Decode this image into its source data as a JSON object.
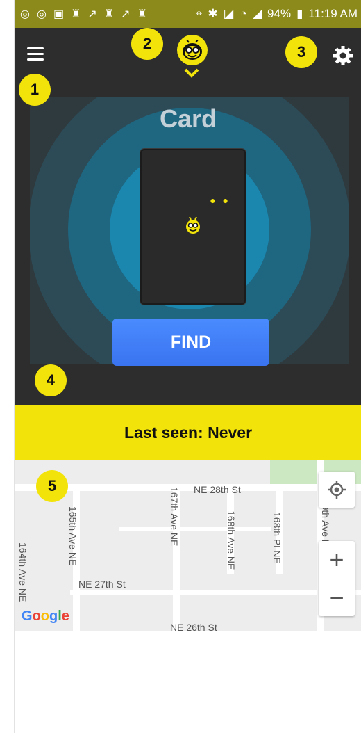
{
  "status_bar": {
    "left_icons": [
      "app-icon",
      "app-icon",
      "sim-icon",
      "usb-icon",
      "missed-call-icon",
      "usb-icon",
      "missed-call-icon",
      "usb-icon"
    ],
    "battery": "94%",
    "time": "11:19 AM"
  },
  "header": {
    "menu_icon": "hamburger-icon",
    "center_icon": "bee-logo",
    "settings_icon": "gear-icon"
  },
  "device": {
    "title": "Card",
    "find_label": "FIND"
  },
  "last_seen": "Last seen: Never",
  "map": {
    "streets": {
      "ne28": "NE 28th St",
      "ne27": "NE 27th St",
      "ne26": "NE 26th St",
      "ave165": "165th Ave NE",
      "ave164": "164th Ave NE",
      "ave167": "167th Ave NE",
      "ave168": "168th Ave NE",
      "pl168": "168th Pl NE",
      "ave169": "169th Ave NE"
    },
    "attribution": "Google",
    "zoom_in": "+",
    "zoom_out": "−"
  },
  "annotations": [
    "1",
    "2",
    "3",
    "4",
    "5"
  ],
  "colors": {
    "accent_yellow": "#f2e40a",
    "dark_bg": "#2d2d2d",
    "find_blue": "#3a74f0",
    "ring_outer": "#2f4f5c",
    "ring_mid": "#1c6d8a",
    "ring_inner": "#1b86ae"
  }
}
